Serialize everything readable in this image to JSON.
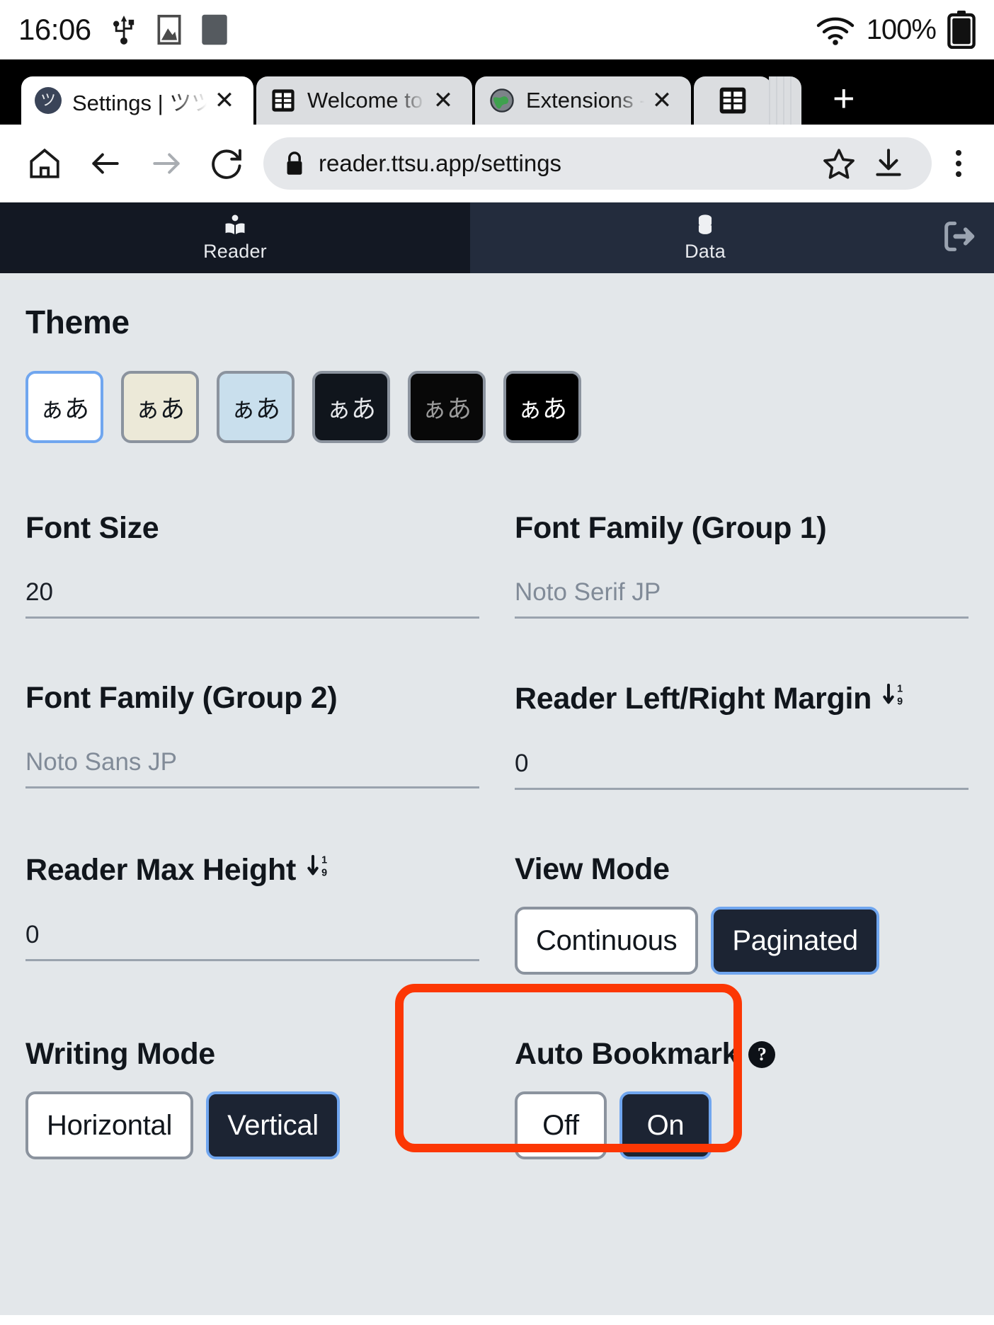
{
  "status_bar": {
    "clock": "16:06",
    "battery_percent": "100%",
    "icons": [
      "usb-icon",
      "image-icon",
      "square-icon",
      "wifi-icon",
      "battery-icon"
    ]
  },
  "browser": {
    "tabs": [
      {
        "title": "Settings | ツツ E",
        "favicon": "ttsu-favicon",
        "active": true,
        "close_label": "✕"
      },
      {
        "title": "Welcome to Yom",
        "favicon": "grid-favicon",
        "active": false,
        "close_label": "✕"
      },
      {
        "title": "Extensions - Yom",
        "favicon": "globe-favicon",
        "active": false,
        "close_label": "✕"
      }
    ],
    "tab_stack_icon": "grid-icon",
    "new_tab_label": "+",
    "toolbar": {
      "home": "home-icon",
      "back": "back-arrow-icon",
      "forward": "forward-arrow-icon",
      "reload": "reload-icon",
      "lock": "lock-icon",
      "url": "reader.ttsu.app/settings",
      "bookmark": "star-icon",
      "download": "download-icon",
      "menu": "overflow-menu-icon"
    }
  },
  "app_nav": {
    "tabs": [
      {
        "label": "Reader",
        "icon": "book-reader-icon",
        "active": true
      },
      {
        "label": "Data",
        "icon": "database-icon",
        "active": false
      }
    ],
    "logout_icon": "logout-icon"
  },
  "settings": {
    "theme": {
      "title": "Theme",
      "sample_text": "ぁあ",
      "swatches": [
        {
          "name": "light-white",
          "bg": "#ffffff",
          "fg": "#11161c",
          "selected": true
        },
        {
          "name": "sepia-cream",
          "bg": "#ece9d8",
          "fg": "#11161c",
          "selected": false
        },
        {
          "name": "light-blue",
          "bg": "#c9dfed",
          "fg": "#11161c",
          "selected": false
        },
        {
          "name": "dark-navy",
          "bg": "#10151c",
          "fg": "#e7e9ec",
          "selected": false
        },
        {
          "name": "dark-dim",
          "bg": "#080808",
          "fg": "#9b9b9b",
          "selected": false
        },
        {
          "name": "pure-black",
          "bg": "#000000",
          "fg": "#ffffff",
          "selected": false
        }
      ]
    },
    "font_size": {
      "label": "Font Size",
      "value": "20",
      "is_placeholder": false
    },
    "font_family_1": {
      "label": "Font Family (Group 1)",
      "value": "Noto Serif JP",
      "is_placeholder": true
    },
    "font_family_2": {
      "label": "Font Family (Group 2)",
      "value": "Noto Sans JP",
      "is_placeholder": true
    },
    "left_right_margin": {
      "label": "Reader Left/Right Margin",
      "icon": "sort-numeric-down-icon",
      "value": "0",
      "is_placeholder": false
    },
    "max_height": {
      "label": "Reader Max Height",
      "icon": "sort-numeric-down-icon",
      "value": "0",
      "is_placeholder": false
    },
    "view_mode": {
      "label": "View Mode",
      "options": [
        {
          "label": "Continuous",
          "selected": false
        },
        {
          "label": "Paginated",
          "selected": true
        }
      ]
    },
    "writing_mode": {
      "label": "Writing Mode",
      "options": [
        {
          "label": "Horizontal",
          "selected": false
        },
        {
          "label": "Vertical",
          "selected": true
        }
      ]
    },
    "auto_bookmark": {
      "label": "Auto Bookmark",
      "help_icon": "question-mark-icon",
      "help_label": "?",
      "options": [
        {
          "label": "Off",
          "selected": false
        },
        {
          "label": "On",
          "selected": true
        }
      ],
      "highlighted": true,
      "highlight_color": "#fc3704"
    }
  }
}
